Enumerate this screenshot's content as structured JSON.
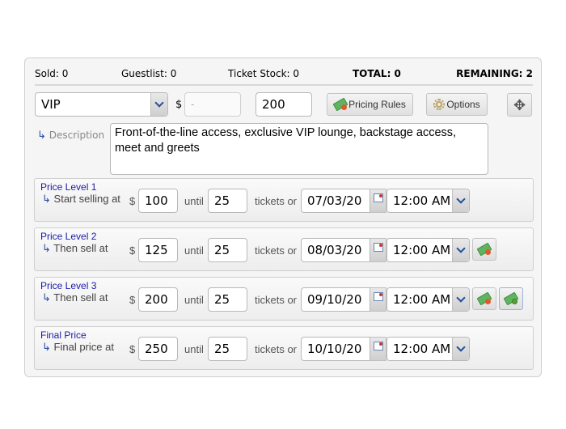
{
  "stats": {
    "sold": "Sold: 0",
    "guestlist": "Guestlist: 0",
    "ticket_stock": "Ticket Stock: 0",
    "total": "TOTAL: 0",
    "remaining": "REMAINING: 2"
  },
  "ticket": {
    "type_value": "VIP",
    "currency_symbol": "$",
    "price_placeholder": "-",
    "quantity_value": "200",
    "pricing_rules_label": "Pricing Rules",
    "options_label": "Options",
    "description_label": "Description",
    "description_arrow": "↳",
    "description_value": "Front-of-the-line access, exclusive VIP lounge, backstage access, meet and greets"
  },
  "common": {
    "currency": "$",
    "until": "until",
    "tickets_or": "tickets or",
    "arrow": "↳"
  },
  "levels": [
    {
      "title": "Price Level 1",
      "subtitle": "Start selling at",
      "price": "100",
      "until_qty": "25",
      "date": "07/03/20",
      "time": "12:00 AM"
    },
    {
      "title": "Price Level 2",
      "subtitle": "Then sell at",
      "price": "125",
      "until_qty": "25",
      "date": "08/03/20",
      "time": "12:00 AM"
    },
    {
      "title": "Price Level 3",
      "subtitle": "Then sell at",
      "price": "200",
      "until_qty": "25",
      "date": "09/10/20",
      "time": "12:00 AM"
    },
    {
      "title": "Final Price",
      "subtitle": "Final price at",
      "price": "250",
      "until_qty": "25",
      "date": "10/10/20",
      "time": "12:00 AM"
    }
  ]
}
